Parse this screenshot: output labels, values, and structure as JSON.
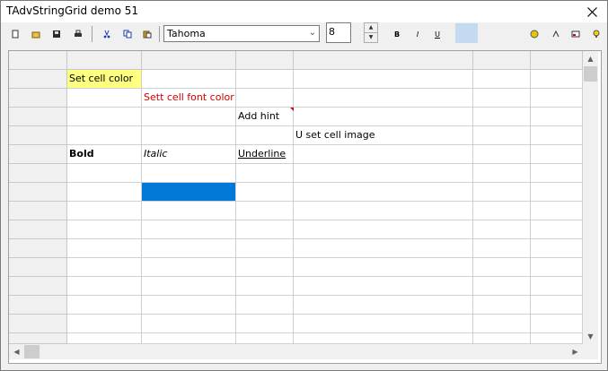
{
  "window": {
    "title": "TAdvStringGrid demo 51"
  },
  "toolbar": {
    "buttons_left": [
      "new-icon",
      "open-icon",
      "save-icon",
      "print-icon"
    ],
    "buttons_edit": [
      "cut-icon",
      "copy-icon",
      "paste-icon"
    ],
    "font_name": "Tahoma",
    "font_size": "8",
    "format_buttons": [
      "bold-icon",
      "italic-icon",
      "underline-icon"
    ],
    "highlight_color": "#c3daf1",
    "buttons_right": [
      "cell-color-icon",
      "font-color-icon",
      "image-icon",
      "hint-icon"
    ]
  },
  "grid": {
    "selected_cell_color": "#0078d7",
    "yellow_cell_color": "#ffff80",
    "red_text_color": "#d40000",
    "cells": {
      "set_cell_color": "Set cell color",
      "set_font_color": "Sett cell font color",
      "add_hint": "Add hint",
      "set_cell_image": "U set cell image",
      "bold": "Bold",
      "italic": "Italic",
      "underline": "Underline"
    }
  }
}
